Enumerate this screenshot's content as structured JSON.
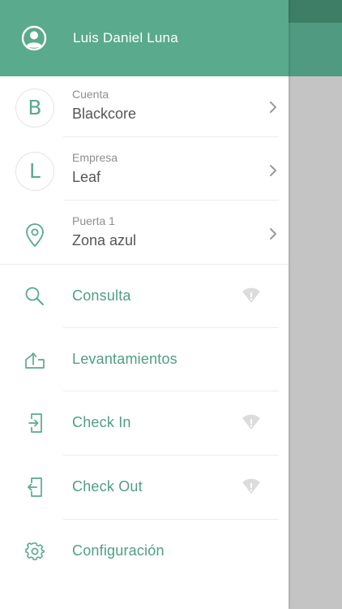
{
  "user": {
    "name": "Luis Daniel Luna",
    "avatar_icon": "user-circle-icon"
  },
  "context": [
    {
      "id": "cuenta",
      "badge": "B",
      "label": "Cuenta",
      "value": "Blackcore"
    },
    {
      "id": "empresa",
      "badge": "L",
      "label": "Empresa",
      "value": "Leaf"
    },
    {
      "id": "puerta",
      "icon": "location-pin-icon",
      "label": "Puerta 1",
      "value": "Zona azul"
    }
  ],
  "menu": [
    {
      "id": "consulta",
      "label": "Consulta",
      "icon": "search-icon",
      "offline_indicator": true
    },
    {
      "id": "levantamientos",
      "label": "Levantamientos",
      "icon": "upload-tray-icon",
      "offline_indicator": false
    },
    {
      "id": "check-in",
      "label": "Check In",
      "icon": "check-in-icon",
      "offline_indicator": true
    },
    {
      "id": "check-out",
      "label": "Check Out",
      "icon": "check-out-icon",
      "offline_indicator": true
    },
    {
      "id": "configuracion",
      "label": "Configuración",
      "icon": "gear-icon",
      "offline_indicator": false
    }
  ],
  "colors": {
    "primary": "#5aaa8d",
    "primary_dark": "#3e7d66",
    "scrim": "#c4c4c4",
    "icon_muted": "#dcdcdc"
  }
}
